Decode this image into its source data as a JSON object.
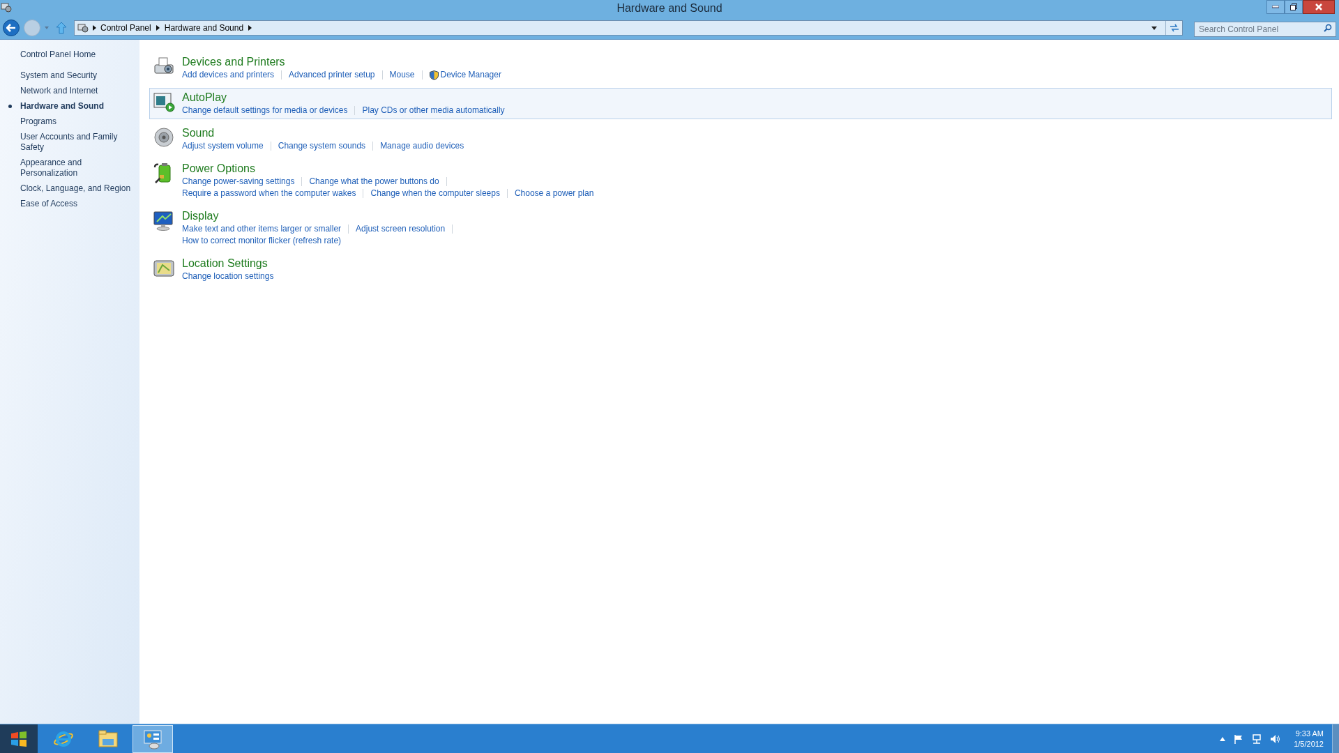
{
  "window": {
    "title": "Hardware and Sound"
  },
  "address_bar": {
    "breadcrumbs": [
      "Control Panel",
      "Hardware and Sound"
    ]
  },
  "search": {
    "placeholder": "Search Control Panel"
  },
  "sidebar": {
    "home": "Control Panel Home",
    "items": [
      {
        "label": "System and Security",
        "selected": false
      },
      {
        "label": "Network and Internet",
        "selected": false
      },
      {
        "label": "Hardware and Sound",
        "selected": true
      },
      {
        "label": "Programs",
        "selected": false
      },
      {
        "label": "User Accounts and Family Safety",
        "selected": false
      },
      {
        "label": "Appearance and Personalization",
        "selected": false
      },
      {
        "label": "Clock, Language, and Region",
        "selected": false
      },
      {
        "label": "Ease of Access",
        "selected": false
      }
    ]
  },
  "categories": [
    {
      "title": "Devices and Printers",
      "kind": "printer",
      "highlighted": false,
      "lines": [
        [
          {
            "label": "Add devices and printers",
            "shield": false
          },
          {
            "label": "Advanced printer setup",
            "shield": false
          },
          {
            "label": "Mouse",
            "shield": false
          },
          {
            "label": "Device Manager",
            "shield": true
          }
        ]
      ]
    },
    {
      "title": "AutoPlay",
      "kind": "autoplay",
      "highlighted": true,
      "lines": [
        [
          {
            "label": "Change default settings for media or devices",
            "shield": false
          },
          {
            "label": "Play CDs or other media automatically",
            "shield": false
          }
        ]
      ]
    },
    {
      "title": "Sound",
      "kind": "speaker",
      "highlighted": false,
      "lines": [
        [
          {
            "label": "Adjust system volume",
            "shield": false
          },
          {
            "label": "Change system sounds",
            "shield": false
          },
          {
            "label": "Manage audio devices",
            "shield": false
          }
        ]
      ]
    },
    {
      "title": "Power Options",
      "kind": "battery",
      "highlighted": false,
      "lines": [
        [
          {
            "label": "Change power-saving settings",
            "shield": false
          },
          {
            "label": "Change what the power buttons do",
            "shield": false
          }
        ],
        [
          {
            "label": "Require a password when the computer wakes",
            "shield": false
          },
          {
            "label": "Change when the computer sleeps",
            "shield": false
          },
          {
            "label": "Choose a power plan",
            "shield": false
          }
        ]
      ]
    },
    {
      "title": "Display",
      "kind": "monitor",
      "highlighted": false,
      "lines": [
        [
          {
            "label": "Make text and other items larger or smaller",
            "shield": false
          },
          {
            "label": "Adjust screen resolution",
            "shield": false
          }
        ],
        [
          {
            "label": "How to correct monitor flicker (refresh rate)",
            "shield": false
          }
        ]
      ]
    },
    {
      "title": "Location Settings",
      "kind": "map",
      "highlighted": false,
      "lines": [
        [
          {
            "label": "Change location settings",
            "shield": false
          }
        ]
      ]
    }
  ],
  "taskbar": {
    "apps": [
      {
        "kind": "browser",
        "active": false
      },
      {
        "kind": "folder",
        "active": false
      },
      {
        "kind": "control-panel",
        "active": true
      }
    ],
    "clock": {
      "time": "9:33 AM",
      "date": "1/5/2012"
    }
  }
}
